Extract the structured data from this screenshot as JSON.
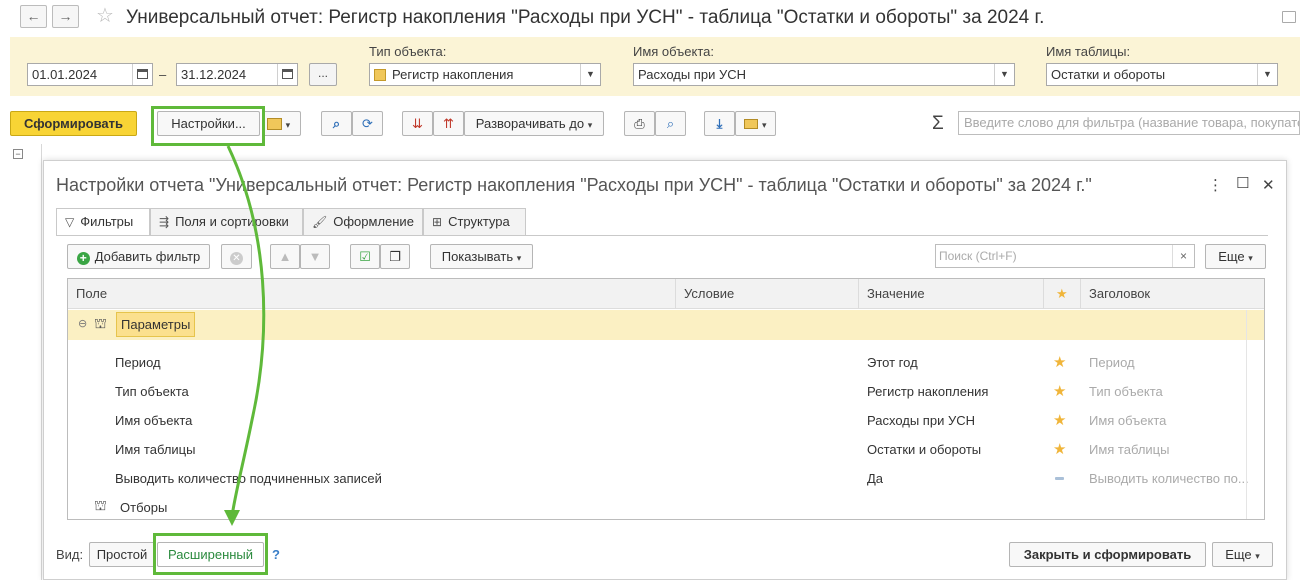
{
  "window": {
    "title": "Универсальный отчет: Регистр накопления \"Расходы при УСН\" - таблица \"Остатки и обороты\" за 2024 г.",
    "back_icon": "arrow-left-icon",
    "forward_icon": "arrow-right-icon",
    "favorite_icon": "star-icon"
  },
  "params": {
    "date_from": "01.01.2024",
    "date_to": "31.12.2024",
    "dash": "–",
    "dots": "...",
    "object_type_label": "Тип объекта:",
    "object_type_value": "Регистр накопления",
    "object_name_label": "Имя объекта:",
    "object_name_value": "Расходы при УСН",
    "table_name_label": "Имя таблицы:",
    "table_name_value": "Остатки и обороты"
  },
  "toolbar": {
    "generate": "Сформировать",
    "settings": "Настройки...",
    "expand_to": "Разворачивать до",
    "sigma": "Σ",
    "search_placeholder": "Введите слово для фильтра (название товара, покупателя ...)"
  },
  "dialog": {
    "title": "Настройки отчета \"Универсальный отчет: Регистр накопления \"Расходы при УСН\" - таблица \"Остатки и обороты\" за 2024 г.\"",
    "menu": "⋮",
    "maximize": "☐",
    "close": "✕",
    "tabs": [
      {
        "label": "Фильтры",
        "icon": "filter-icon",
        "active": true
      },
      {
        "label": "Поля и сортировки",
        "icon": "columns-icon",
        "active": false
      },
      {
        "label": "Оформление",
        "icon": "brush-icon",
        "active": false
      },
      {
        "label": "Структура",
        "icon": "structure-icon",
        "active": false
      }
    ],
    "add_filter": "Добавить фильтр",
    "show": "Показывать",
    "search_placeholder": "Поиск (Ctrl+F)",
    "clear": "×",
    "more": "Еще",
    "columns": [
      "Поле",
      "Условие",
      "Значение",
      "★",
      "Заголовок"
    ],
    "group_label": "Параметры",
    "rows": [
      {
        "field": "Период",
        "value": "Этот год",
        "mark": "star",
        "caption": "Период"
      },
      {
        "field": "Тип объекта",
        "value": "Регистр накопления",
        "mark": "star",
        "caption": "Тип объекта"
      },
      {
        "field": "Имя объекта",
        "value": "Расходы при УСН",
        "mark": "star",
        "caption": "Имя объекта"
      },
      {
        "field": "Имя таблицы",
        "value": "Остатки и обороты",
        "mark": "star",
        "caption": "Имя таблицы"
      },
      {
        "field": "Выводить количество подчиненных записей",
        "value": "Да",
        "mark": "dash",
        "caption": "Выводить количество по..."
      }
    ],
    "filters_label": "Отборы",
    "view_label": "Вид:",
    "view_simple": "Простой",
    "view_advanced": "Расширенный",
    "help": "?",
    "close_and_generate": "Закрыть и сформировать",
    "more_bottom": "Еще"
  },
  "colors": {
    "accent_yellow": "#f8d435",
    "panel_yellow": "#fbf4d6",
    "annotation_green": "#5fb93a"
  }
}
